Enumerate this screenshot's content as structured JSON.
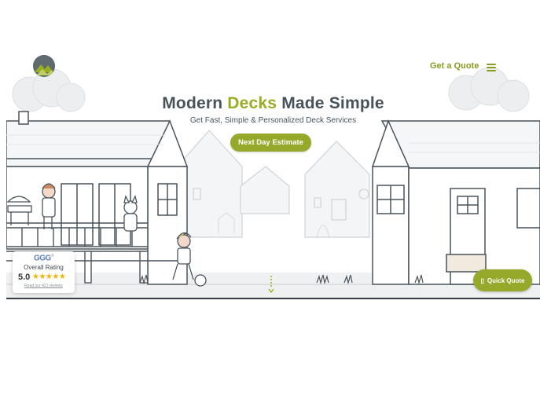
{
  "header": {
    "logo_icon": "mountain-logo-icon",
    "quote_link": "Get a Quote",
    "menu_icon": "hamburger-menu-icon"
  },
  "hero": {
    "title_part1": "Modern ",
    "title_accent": "Decks",
    "title_part2": " Made Simple",
    "subtitle": "Get Fast, Simple & Personalized Deck Services",
    "cta_label": "Next Day Estimate"
  },
  "rating": {
    "brand": "GGG",
    "brand_suffix": "®",
    "label": "Overall Rating",
    "score": "5.0",
    "stars": "★★★★★",
    "stars_value": 5,
    "reviews_link": "Read our 421 reviews"
  },
  "scroll": {
    "icon": "scroll-down-arrow-icon"
  },
  "quick_quote": {
    "label": "Quick Quote",
    "icon": "chat-icon",
    "icon_glyph": "▯"
  },
  "colors": {
    "accent": "#9aac22",
    "button": "#97a92a",
    "heading": "#47525a",
    "line_art": "#4a545a",
    "faded_art": "#c9cdd0",
    "ground": "#e6e8ea",
    "star": "#f0b400"
  }
}
